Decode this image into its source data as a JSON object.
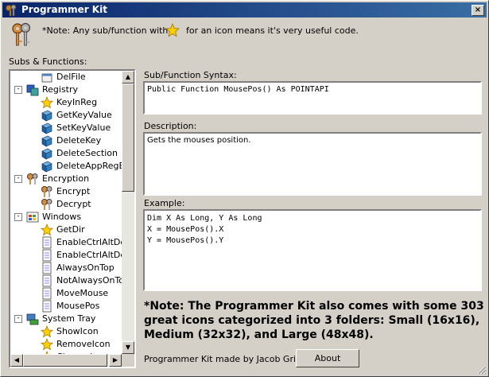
{
  "window": {
    "title": "Programmer Kit",
    "close_label": "×"
  },
  "note": {
    "prefix": "*Note: Any sub/function with a",
    "suffix": "for an icon means it's very useful code."
  },
  "tree": {
    "label": "Subs & Functions:",
    "items": [
      {
        "text": "DelFile",
        "icon": "file-icon",
        "level": 2,
        "expander": ""
      },
      {
        "text": "Registry",
        "icon": "registry-icon",
        "level": 1,
        "expander": "-"
      },
      {
        "text": "KeyInReg",
        "icon": "star-icon",
        "level": 2,
        "expander": ""
      },
      {
        "text": "GetKeyValue",
        "icon": "registry-cube-icon",
        "level": 2,
        "expander": ""
      },
      {
        "text": "SetKeyValue",
        "icon": "registry-cube-icon",
        "level": 2,
        "expander": ""
      },
      {
        "text": "DeleteKey",
        "icon": "registry-cube-icon",
        "level": 2,
        "expander": ""
      },
      {
        "text": "DeleteSection",
        "icon": "registry-cube-icon",
        "level": 2,
        "expander": ""
      },
      {
        "text": "DeleteAppRegEnt",
        "icon": "registry-cube-icon",
        "level": 2,
        "expander": ""
      },
      {
        "text": "Encryption",
        "icon": "keys-icon",
        "level": 1,
        "expander": "-"
      },
      {
        "text": "Encrypt",
        "icon": "keys-icon",
        "level": 2,
        "expander": ""
      },
      {
        "text": "Decrypt",
        "icon": "keys-icon",
        "level": 2,
        "expander": ""
      },
      {
        "text": "Windows",
        "icon": "windows-icon",
        "level": 1,
        "expander": "-"
      },
      {
        "text": "GetDir",
        "icon": "star-icon",
        "level": 2,
        "expander": ""
      },
      {
        "text": "EnableCtrlAltDel",
        "icon": "document-icon",
        "level": 2,
        "expander": ""
      },
      {
        "text": "EnableCtrlAltDel",
        "icon": "document-icon",
        "level": 2,
        "expander": ""
      },
      {
        "text": "AlwaysOnTop",
        "icon": "document-icon",
        "level": 2,
        "expander": ""
      },
      {
        "text": "NotAlwaysOnTop",
        "icon": "document-icon",
        "level": 2,
        "expander": ""
      },
      {
        "text": "MoveMouse",
        "icon": "document-icon",
        "level": 2,
        "expander": ""
      },
      {
        "text": "MousePos",
        "icon": "document-icon",
        "level": 2,
        "expander": ""
      },
      {
        "text": "System Tray",
        "icon": "system-tray-icon",
        "level": 1,
        "expander": "-"
      },
      {
        "text": "ShowIcon",
        "icon": "star-icon",
        "level": 2,
        "expander": ""
      },
      {
        "text": "RemoveIcon",
        "icon": "star-icon",
        "level": 2,
        "expander": ""
      },
      {
        "text": "ChangeIcon",
        "icon": "star-icon",
        "level": 2,
        "expander": ""
      }
    ]
  },
  "syntax": {
    "label": "Sub/Function Syntax:",
    "value": "Public Function MousePos() As POINTAPI"
  },
  "description": {
    "label": "Description:",
    "value": "Gets the mouses position."
  },
  "example": {
    "label": "Example:",
    "lines": [
      "Dim X As Long, Y As Long",
      "X = MousePos().X",
      "Y = MousePos().Y"
    ]
  },
  "big_note": "*Note: The Programmer Kit also comes with some 303 great icons categorized into 3 folders: Small (16x16), Medium (32x32), and Large (48x48).",
  "credit": "Programmer Kit made by Jacob Grice.",
  "about_label": "About"
}
